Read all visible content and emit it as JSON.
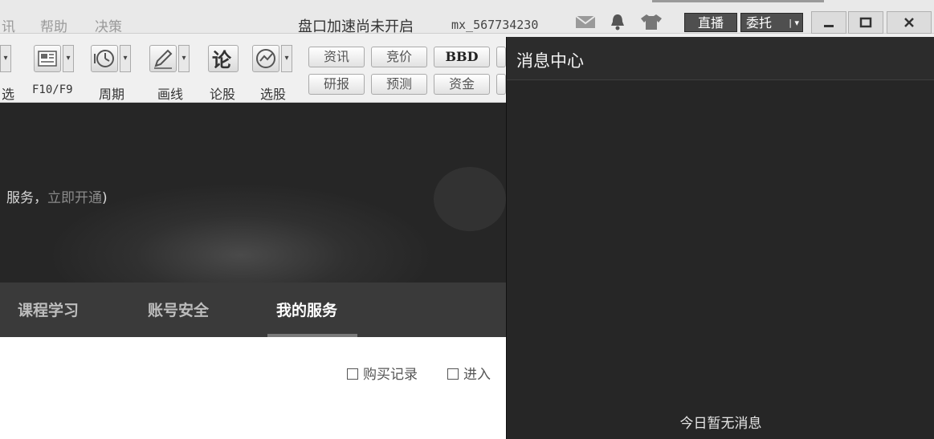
{
  "menubar": {
    "menu_items": [
      "讯",
      "帮助",
      "决策"
    ],
    "status": "盘口加速尚未开启",
    "username": "mx_567734230",
    "live_label": "直播",
    "entrust_label": "委托",
    "icons": [
      "mail-icon",
      "bell-icon",
      "shirt-icon"
    ]
  },
  "toolbar": {
    "tools": [
      {
        "label": "选",
        "icon": "screener-icon"
      },
      {
        "label": "F10/F9",
        "icon": "f10-icon"
      },
      {
        "label": "周期",
        "icon": "clock-icon"
      },
      {
        "label": "画线",
        "icon": "pencil-icon"
      },
      {
        "label": "论股",
        "icon": "forum-icon"
      },
      {
        "label": "选股",
        "icon": "stock-pick-icon"
      }
    ],
    "pills_row1": [
      "资讯",
      "竞价",
      "BBD"
    ],
    "pills_row2": [
      "研报",
      "预测",
      "资金"
    ]
  },
  "banner": {
    "text": "服务，",
    "link": "立即开通",
    "tail": ")"
  },
  "tabs": [
    "课程学习",
    "账号安全",
    "我的服务"
  ],
  "active_tab": "我的服务",
  "links": {
    "purchase": "购买记录",
    "enter": "进入"
  },
  "message_center": {
    "title": "消息中心",
    "empty": "今日暂无消息"
  }
}
